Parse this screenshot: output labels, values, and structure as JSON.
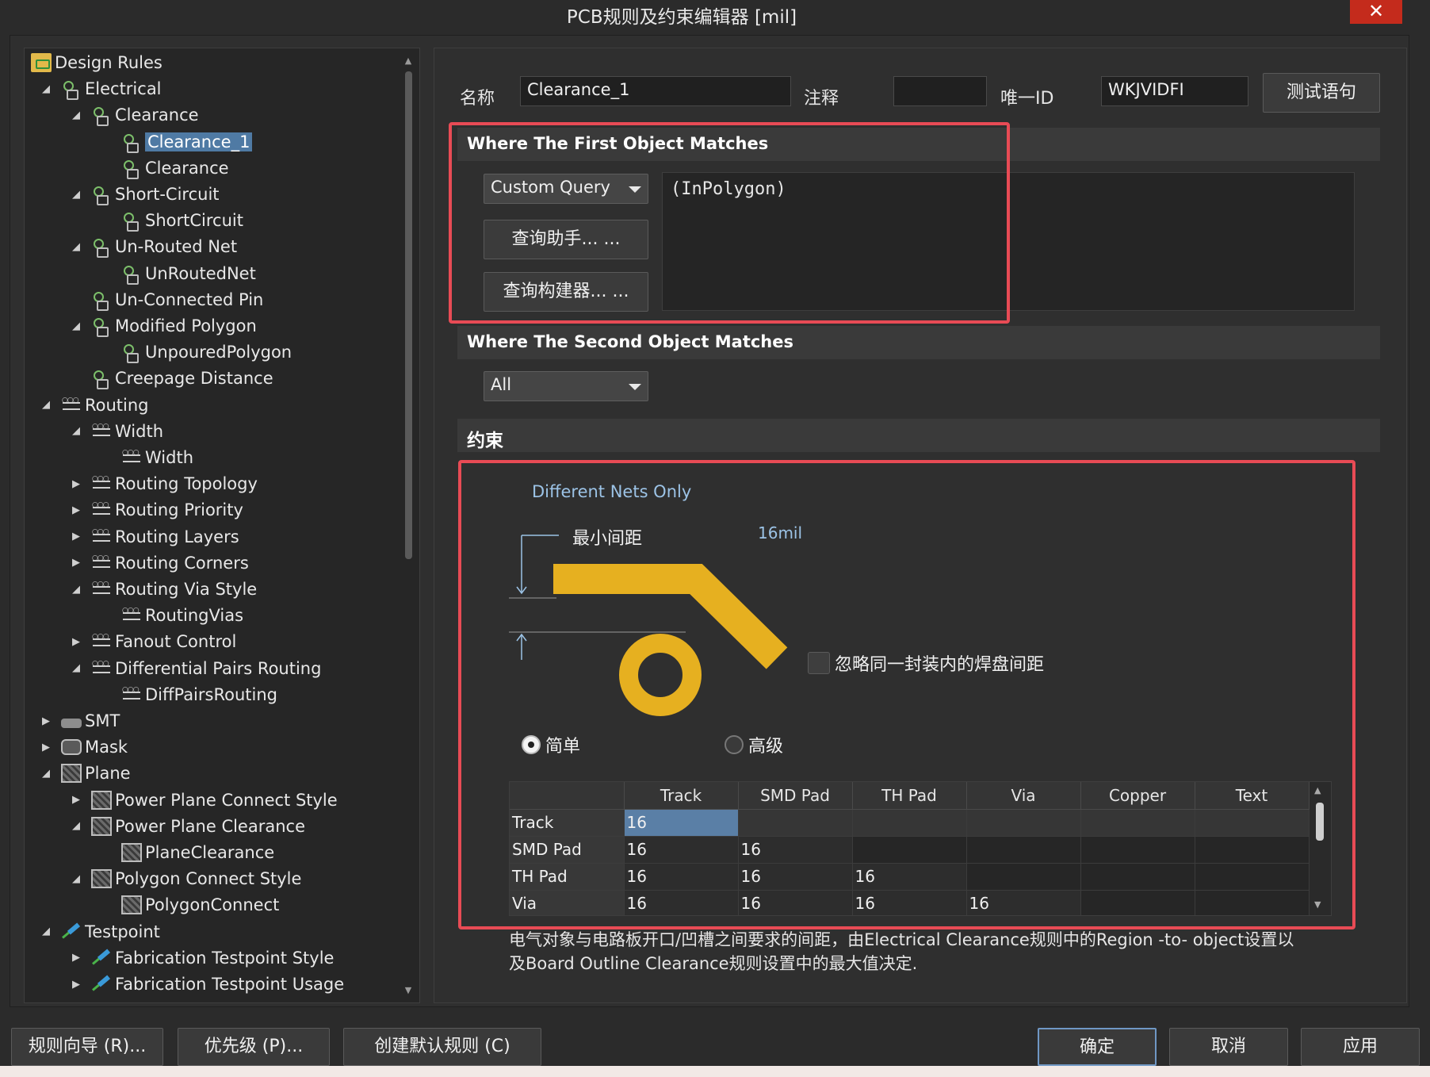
{
  "window": {
    "title": "PCB规则及约束编辑器 [mil]",
    "close_glyph": "✕"
  },
  "tree": {
    "rows": [
      {
        "label": "Design Rules",
        "arrow": "◢",
        "icon": "folder-icon"
      },
      {
        "label": "Electrical",
        "arrow": "◢",
        "icon": "electrical-rule-icon"
      },
      {
        "label": "Clearance",
        "arrow": "◢",
        "icon": "electrical-rule-icon"
      },
      {
        "label": "Clearance_1",
        "arrow": "",
        "icon": "electrical-rule-icon",
        "selected": true
      },
      {
        "label": "Clearance",
        "arrow": "",
        "icon": "electrical-rule-icon"
      },
      {
        "label": "Short-Circuit",
        "arrow": "◢",
        "icon": "electrical-rule-icon"
      },
      {
        "label": "ShortCircuit",
        "arrow": "",
        "icon": "electrical-rule-icon"
      },
      {
        "label": "Un-Routed Net",
        "arrow": "◢",
        "icon": "electrical-rule-icon"
      },
      {
        "label": "UnRoutedNet",
        "arrow": "",
        "icon": "electrical-rule-icon"
      },
      {
        "label": "Un-Connected Pin",
        "arrow": "",
        "icon": "electrical-rule-icon"
      },
      {
        "label": "Modified Polygon",
        "arrow": "◢",
        "icon": "electrical-rule-icon"
      },
      {
        "label": "UnpouredPolygon",
        "arrow": "",
        "icon": "electrical-rule-icon"
      },
      {
        "label": "Creepage Distance",
        "arrow": "",
        "icon": "electrical-rule-icon"
      },
      {
        "label": "Routing",
        "arrow": "◢",
        "icon": "routing-rule-icon"
      },
      {
        "label": "Width",
        "arrow": "◢",
        "icon": "routing-rule-icon"
      },
      {
        "label": "Width",
        "arrow": "",
        "icon": "routing-rule-icon"
      },
      {
        "label": "Routing Topology",
        "arrow": "▶",
        "icon": "routing-rule-icon"
      },
      {
        "label": "Routing Priority",
        "arrow": "▶",
        "icon": "routing-rule-icon"
      },
      {
        "label": "Routing Layers",
        "arrow": "▶",
        "icon": "routing-rule-icon"
      },
      {
        "label": "Routing Corners",
        "arrow": "▶",
        "icon": "routing-rule-icon"
      },
      {
        "label": "Routing Via Style",
        "arrow": "◢",
        "icon": "routing-rule-icon"
      },
      {
        "label": "RoutingVias",
        "arrow": "",
        "icon": "routing-rule-icon"
      },
      {
        "label": "Fanout Control",
        "arrow": "▶",
        "icon": "routing-rule-icon"
      },
      {
        "label": "Differential Pairs Routing",
        "arrow": "◢",
        "icon": "routing-rule-icon"
      },
      {
        "label": "DiffPairsRouting",
        "arrow": "",
        "icon": "routing-rule-icon"
      },
      {
        "label": "SMT",
        "arrow": "▶",
        "icon": "smt-rule-icon"
      },
      {
        "label": "Mask",
        "arrow": "▶",
        "icon": "mask-rule-icon"
      },
      {
        "label": "Plane",
        "arrow": "◢",
        "icon": "plane-rule-icon"
      },
      {
        "label": "Power Plane Connect Style",
        "arrow": "▶",
        "icon": "plane-rule-icon"
      },
      {
        "label": "Power Plane Clearance",
        "arrow": "◢",
        "icon": "plane-rule-icon"
      },
      {
        "label": "PlaneClearance",
        "arrow": "",
        "icon": "plane-rule-icon"
      },
      {
        "label": "Polygon Connect Style",
        "arrow": "◢",
        "icon": "plane-rule-icon"
      },
      {
        "label": "PolygonConnect",
        "arrow": "",
        "icon": "plane-rule-icon"
      },
      {
        "label": "Testpoint",
        "arrow": "◢",
        "icon": "testpoint-rule-icon"
      },
      {
        "label": "Fabrication Testpoint Style",
        "arrow": "▶",
        "icon": "testpoint-rule-icon"
      },
      {
        "label": "Fabrication Testpoint Usage",
        "arrow": "▶",
        "icon": "testpoint-rule-icon"
      }
    ],
    "scroll_up": "▲",
    "scroll_down": "▼"
  },
  "header": {
    "name_label": "名称",
    "name_value": "Clearance_1",
    "comment_label": "注释",
    "comment_value": "",
    "uid_label": "唯一ID",
    "uid_value": "WKJVIDFI",
    "test_button": "测试语句"
  },
  "first_match": {
    "title": "Where The First Object Matches",
    "dropdown_value": "Custom Query",
    "query_helper": "查询助手... ...",
    "query_builder": "查询构建器... ...",
    "query_text": "(InPolygon)"
  },
  "second_match": {
    "title": "Where The Second Object Matches",
    "dropdown_value": "All"
  },
  "constraints": {
    "title": "约束",
    "different_nets": "Different Nets Only",
    "min_clearance_label": "最小间距",
    "min_clearance_value": "16mil",
    "ignore_pads_label": "忽略同一封装内的焊盘间距",
    "radio_simple": "简单",
    "radio_advanced": "高级",
    "track_color": "#e6b020"
  },
  "grid": {
    "columns": [
      "Track",
      "SMD Pad",
      "TH Pad",
      "Via",
      "Copper",
      "Text"
    ],
    "rows": [
      {
        "name": "Track",
        "cells": [
          "16",
          "",
          "",
          "",
          "",
          ""
        ]
      },
      {
        "name": "SMD Pad",
        "cells": [
          "16",
          "16",
          "",
          "",
          "",
          ""
        ]
      },
      {
        "name": "TH Pad",
        "cells": [
          "16",
          "16",
          "16",
          "",
          "",
          ""
        ]
      },
      {
        "name": "Via",
        "cells": [
          "16",
          "16",
          "16",
          "16",
          "",
          ""
        ]
      }
    ],
    "scroll_up": "▲",
    "scroll_down": "▼"
  },
  "note": {
    "line1": "电气对象与电路板开口/凹槽之间要求的间距，由Electrical Clearance规则中的Region -to- object设置以",
    "line2": "及Board Outline Clearance规则设置中的最大值决定."
  },
  "footer": {
    "wizard": "规则向导 (R)...",
    "priority": "优先级 (P)...",
    "create_default": "创建默认规则 (C)",
    "ok": "确定",
    "cancel": "取消",
    "apply": "应用"
  }
}
